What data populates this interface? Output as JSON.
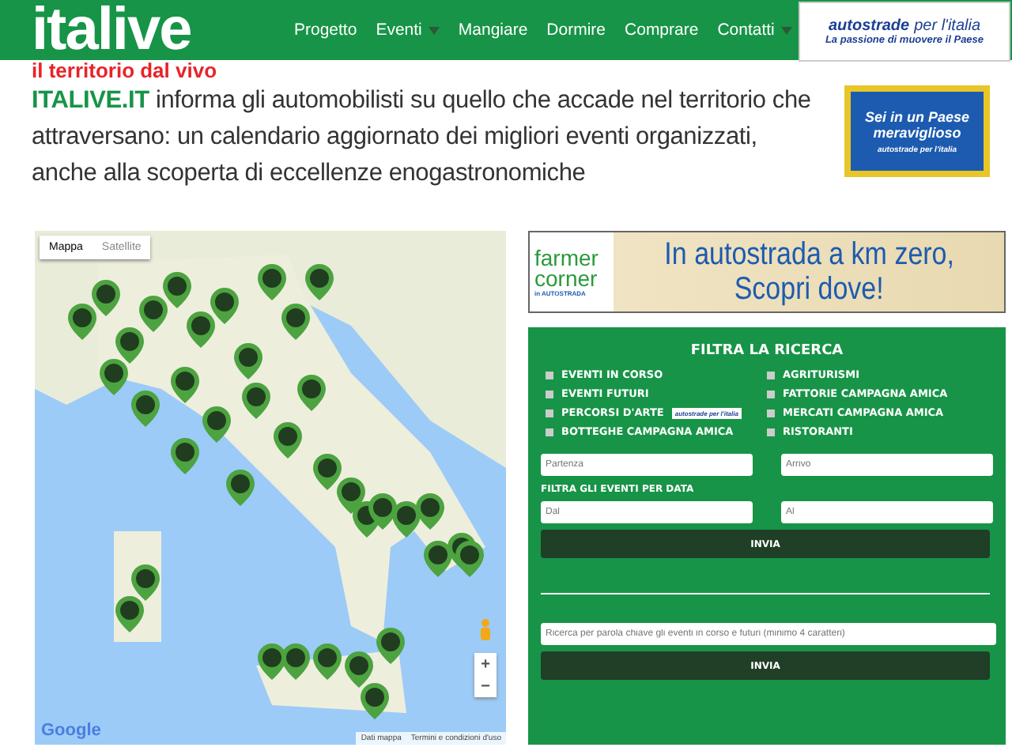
{
  "header": {
    "logo": "italive",
    "tagline": "il territorio dal vivo",
    "nav": [
      {
        "label": "Progetto",
        "dropdown": false
      },
      {
        "label": "Eventi",
        "dropdown": true
      },
      {
        "label": "Mangiare",
        "dropdown": false
      },
      {
        "label": "Dormire",
        "dropdown": false
      },
      {
        "label": "Comprare",
        "dropdown": false
      },
      {
        "label": "Contatti",
        "dropdown": true
      }
    ],
    "sponsor": {
      "brand": "autostrade",
      "brand_suffix": "per l'italia",
      "slogan": "La passione di muovere il Paese"
    }
  },
  "intro": {
    "text": "**ITALIVE.IT** informa gli automobilisti su quello che accade nel territorio che attraversano: un calendario aggiornato dei migliori eventi organizzati, anche alla scoperta di eccellenze enogastronomiche"
  },
  "ad": {
    "line1": "Sei in un Paese",
    "line2": "meraviglioso",
    "brand": "autostrade",
    "brand_suffix": "per l'italia"
  },
  "map": {
    "types": [
      {
        "label": "Mappa",
        "selected": true
      },
      {
        "label": "Satellite",
        "selected": false
      }
    ],
    "google": "Google",
    "attribution": [
      "Dati mappa",
      "Termini e condizioni d'uso"
    ],
    "zoom_in": "+",
    "zoom_out": "−"
  },
  "banner": {
    "logo_top": "farmer",
    "logo_mid": "corner",
    "logo_bottom": "in AUTOSTRADA",
    "line1": "In autostrada a km zero,",
    "line2": "Scopri dove!"
  },
  "filter": {
    "title": "FILTRA LA RICERCA",
    "options": [
      {
        "label": "EVENTI IN CORSO",
        "checked": false
      },
      {
        "label": "AGRITURISMI",
        "checked": false
      },
      {
        "label": "EVENTI FUTURI",
        "checked": false
      },
      {
        "label": "FATTORIE CAMPAGNA AMICA",
        "checked": false
      },
      {
        "label": "PERCORSI D'ARTE",
        "checked": false,
        "badge": "autostrade",
        "badge_suffix": "per l'italia"
      },
      {
        "label": "MERCATI CAMPAGNA AMICA",
        "checked": false
      },
      {
        "label": "BOTTEGHE CAMPAGNA AMICA",
        "checked": false
      },
      {
        "label": "RISTORANTI",
        "checked": false
      }
    ],
    "from": {
      "placeholder": "Partenza"
    },
    "to": {
      "placeholder": "Arrivo"
    },
    "date_title": "FILTRA GLI EVENTI PER DATA",
    "date_from": {
      "placeholder": "Dal"
    },
    "date_to": {
      "placeholder": "Al"
    },
    "submit": "INVIA",
    "keyword": {
      "placeholder": "Ricerca per parola chiave gli eventi in corso e futuri (minimo 4 caratteri)"
    },
    "submit2": "INVIA"
  }
}
